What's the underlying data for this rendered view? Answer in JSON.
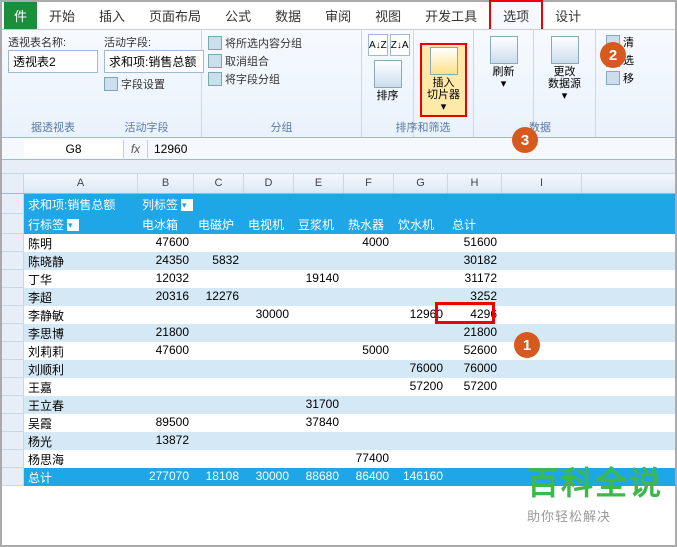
{
  "tabs": {
    "file": "件",
    "start": "开始",
    "insert": "插入",
    "layout": "页面布局",
    "formula": "公式",
    "data": "数据",
    "review": "审阅",
    "view": "视图",
    "dev": "开发工具",
    "option": "选项",
    "design": "设计"
  },
  "ribbon": {
    "pt_name_label": "透视表名称:",
    "pt_name": "透视表2",
    "active_field_label": "活动字段:",
    "active_field": "求和项:销售总额",
    "field_settings": "字段设置",
    "group_active": "活动字段",
    "group_below": "据透视表",
    "sel_group": "将所选内容分组",
    "ungroup": "取消组合",
    "field_group": "将字段分组",
    "group_group": "分组",
    "sort": "排序",
    "sort_group": "排序和筛选",
    "az": "A↓Z",
    "za": "Z↓A",
    "slicer_l1": "插入",
    "slicer_l2": "切片器",
    "refresh": "刷新",
    "source_l1": "更改",
    "source_l2": "数据源",
    "data_group": "数据",
    "r1": "清",
    "r2": "选",
    "r3": "移"
  },
  "fbar": {
    "name": "G8",
    "val": "12960"
  },
  "cols": {
    "A": "A",
    "B": "B",
    "C": "C",
    "D": "D",
    "E": "E",
    "F": "F",
    "G": "G",
    "H": "H",
    "I": "I"
  },
  "head1": {
    "sum": "求和项:销售总额",
    "cols": "列标签"
  },
  "head2": {
    "row": "行标签",
    "b": "电冰箱",
    "c": "电磁炉",
    "d": "电视机",
    "e": "豆浆机",
    "f": "热水器",
    "g": "饮水机",
    "h": "总计"
  },
  "rows": [
    {
      "a": "陈明",
      "b": "47600",
      "f": "4000",
      "h": "51600"
    },
    {
      "a": "陈晓静",
      "b": "24350",
      "c": "5832",
      "h": "30182"
    },
    {
      "a": "丁华",
      "b": "12032",
      "e": "19140",
      "h": "31172"
    },
    {
      "a": "李超",
      "b": "20316",
      "c": "12276",
      "h": "3252"
    },
    {
      "a": "李静敏",
      "d": "30000",
      "g": "12960",
      "h": "4296"
    },
    {
      "a": "李思博",
      "b": "21800",
      "h": "21800"
    },
    {
      "a": "刘莉莉",
      "b": "47600",
      "f": "5000",
      "h": "52600"
    },
    {
      "a": "刘顺利",
      "g": "76000",
      "h": "76000"
    },
    {
      "a": "王嘉",
      "g": "57200",
      "h": "57200"
    },
    {
      "a": "王立春",
      "e": "31700"
    },
    {
      "a": "吴霞",
      "b": "89500",
      "e": "37840"
    },
    {
      "a": "杨光",
      "b": "13872"
    },
    {
      "a": "杨思海",
      "f": "77400"
    },
    {
      "a": "总计",
      "b": "277070",
      "c": "18108",
      "d": "30000",
      "e": "88680",
      "f": "86400",
      "g": "146160"
    }
  ],
  "watermark": {
    "big": "百科全说",
    "small": "助你轻松解决"
  }
}
